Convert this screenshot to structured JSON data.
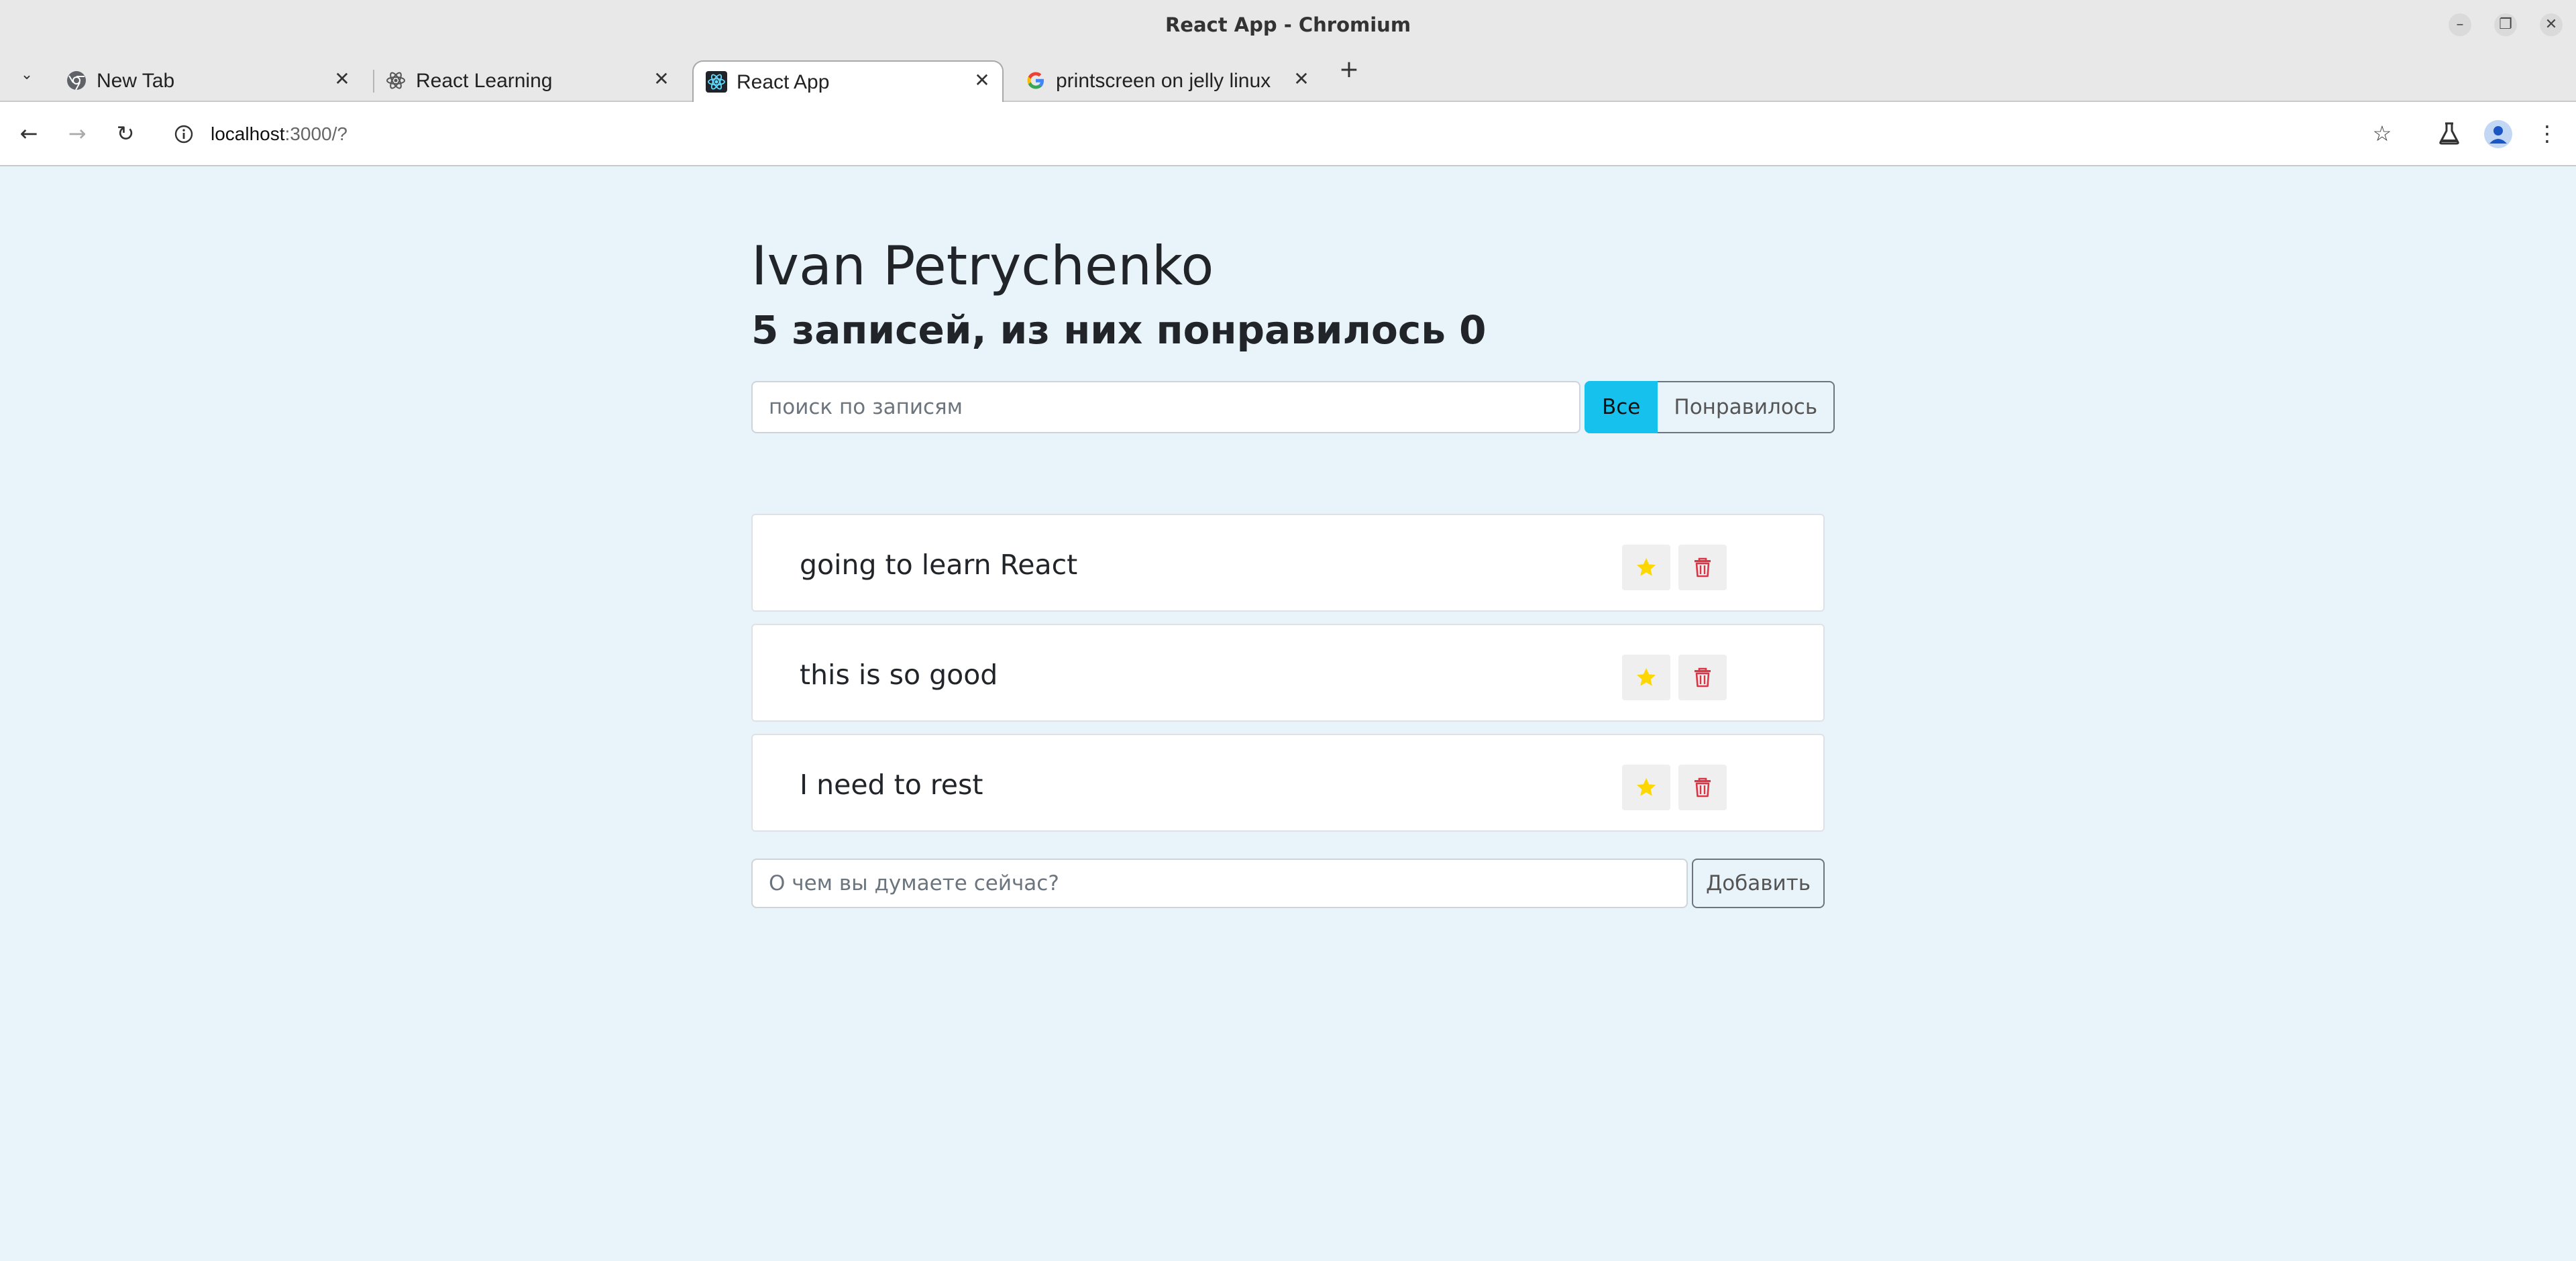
{
  "window": {
    "title": "React App - Chromium",
    "minimize_glyph": "–",
    "restore_glyph": "❐",
    "close_glyph": "✕"
  },
  "tabs": [
    {
      "label": "New Tab",
      "icon": "chromium-icon"
    },
    {
      "label": "React Learning",
      "icon": "react-icon"
    },
    {
      "label": "React App",
      "icon": "react-icon",
      "active": true
    },
    {
      "label": "printscreen on jelly linux",
      "icon": "google-icon"
    }
  ],
  "tab_strip": {
    "dropdown_glyph": "⌄",
    "close_glyph": "✕",
    "new_tab_glyph": "+"
  },
  "toolbar": {
    "back_glyph": "←",
    "forward_glyph": "→",
    "reload_glyph": "↻",
    "url_host": "localhost",
    "url_rest": ":3000/?",
    "bookmark_glyph": "☆",
    "menu_glyph": "⋮"
  },
  "app": {
    "title": "Ivan Petrychenko",
    "subtitle": "5 записей, из них понравилось 0",
    "search_placeholder": "поиск по записям",
    "filter_all": "Все",
    "filter_liked": "Понравилось",
    "posts": [
      {
        "label": "going to learn React"
      },
      {
        "label": "this is so good"
      },
      {
        "label": "I need to rest"
      }
    ],
    "add_placeholder": "О чем вы думаете сейчас?",
    "add_button": "Добавить"
  },
  "colors": {
    "page_bg": "#e9f3fa",
    "active_filter": "#17c1ee",
    "star": "#ffd700",
    "trash": "#dc3545"
  }
}
